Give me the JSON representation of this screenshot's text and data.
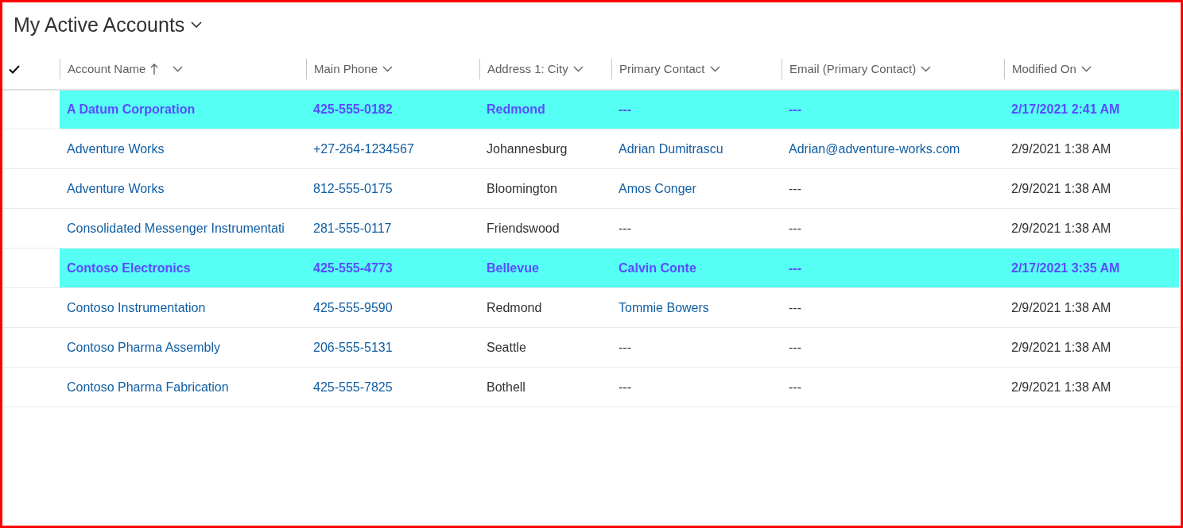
{
  "view": {
    "title": "My Active Accounts"
  },
  "table": {
    "select_all_checked": true,
    "columns": [
      {
        "label": "Account Name",
        "sorted": true
      },
      {
        "label": "Main Phone",
        "sorted": false
      },
      {
        "label": "Address 1: City",
        "sorted": false
      },
      {
        "label": "Primary Contact",
        "sorted": false
      },
      {
        "label": "Email (Primary Contact)",
        "sorted": false
      },
      {
        "label": "Modified On",
        "sorted": false
      }
    ],
    "rows": [
      {
        "highlighted": true,
        "cells": [
          {
            "text": "A Datum Corporation"
          },
          {
            "text": "425-555-0182"
          },
          {
            "text": "Redmond"
          },
          {
            "text": "---"
          },
          {
            "text": "---"
          },
          {
            "text": "2/17/2021 2:41 AM"
          }
        ]
      },
      {
        "highlighted": false,
        "cells": [
          {
            "text": "Adventure Works",
            "link": true
          },
          {
            "text": "+27-264-1234567",
            "link": true
          },
          {
            "text": "Johannesburg",
            "link": false
          },
          {
            "text": "Adrian Dumitrascu",
            "link": true
          },
          {
            "text": "Adrian@adventure-works.com",
            "link": true
          },
          {
            "text": "2/9/2021 1:38 AM",
            "link": false
          }
        ]
      },
      {
        "highlighted": false,
        "cells": [
          {
            "text": "Adventure Works",
            "link": true
          },
          {
            "text": "812-555-0175",
            "link": true
          },
          {
            "text": "Bloomington",
            "link": false
          },
          {
            "text": "Amos Conger",
            "link": true
          },
          {
            "text": "---",
            "link": false
          },
          {
            "text": "2/9/2021 1:38 AM",
            "link": false
          }
        ]
      },
      {
        "highlighted": false,
        "cells": [
          {
            "text": "Consolidated Messenger Instrumentati",
            "link": true
          },
          {
            "text": "281-555-0117",
            "link": true
          },
          {
            "text": "Friendswood",
            "link": false
          },
          {
            "text": "---",
            "link": false
          },
          {
            "text": "---",
            "link": false
          },
          {
            "text": "2/9/2021 1:38 AM",
            "link": false
          }
        ]
      },
      {
        "highlighted": true,
        "cells": [
          {
            "text": "Contoso Electronics"
          },
          {
            "text": "425-555-4773"
          },
          {
            "text": "Bellevue"
          },
          {
            "text": "Calvin Conte"
          },
          {
            "text": "---"
          },
          {
            "text": "2/17/2021 3:35 AM"
          }
        ]
      },
      {
        "highlighted": false,
        "cells": [
          {
            "text": "Contoso Instrumentation",
            "link": true
          },
          {
            "text": "425-555-9590",
            "link": true
          },
          {
            "text": "Redmond",
            "link": false
          },
          {
            "text": "Tommie Bowers",
            "link": true
          },
          {
            "text": "---",
            "link": false
          },
          {
            "text": "2/9/2021 1:38 AM",
            "link": false
          }
        ]
      },
      {
        "highlighted": false,
        "cells": [
          {
            "text": "Contoso Pharma Assembly",
            "link": true
          },
          {
            "text": "206-555-5131",
            "link": true
          },
          {
            "text": "Seattle",
            "link": false
          },
          {
            "text": "---",
            "link": false
          },
          {
            "text": "---",
            "link": false
          },
          {
            "text": "2/9/2021 1:38 AM",
            "link": false
          }
        ]
      },
      {
        "highlighted": false,
        "cells": [
          {
            "text": "Contoso Pharma Fabrication",
            "link": true
          },
          {
            "text": "425-555-7825",
            "link": true
          },
          {
            "text": "Bothell",
            "link": false
          },
          {
            "text": "---",
            "link": false
          },
          {
            "text": "---",
            "link": false
          },
          {
            "text": "2/9/2021 1:38 AM",
            "link": false
          }
        ]
      }
    ]
  }
}
